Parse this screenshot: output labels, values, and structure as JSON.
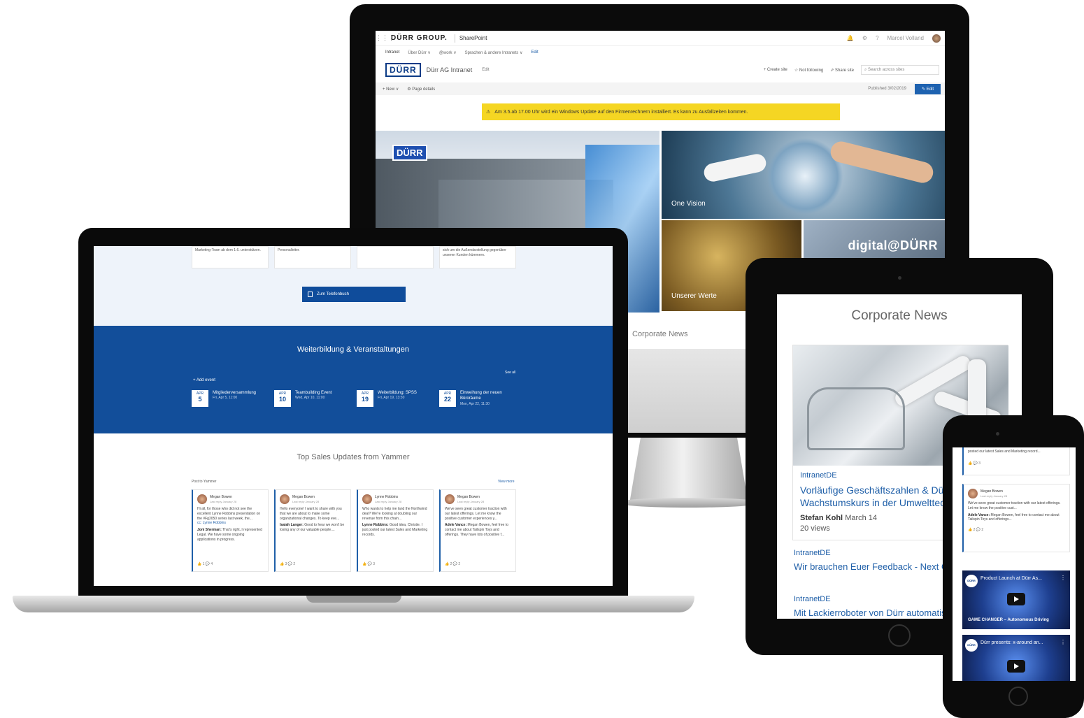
{
  "monitor": {
    "suite": {
      "brand": "DÜRR GROUP.",
      "app": "SharePoint",
      "user": "Marcel Volland",
      "waffle_icon": "waffle-icon"
    },
    "hubnav": [
      "Intranet",
      "Über Dürr ∨",
      "@work ∨",
      "Sprachen & andere Intranets ∨",
      "Edit"
    ],
    "site": {
      "logo": "DÜRR",
      "name": "Dürr AG Intranet",
      "edit": "Edit"
    },
    "actions": {
      "create": "+ Create site",
      "follow": "☆ Not following",
      "share": "⇗ Share site",
      "search_placeholder": "⌕ Search across sites"
    },
    "command": {
      "new": "+ New ∨",
      "page_details": "⚙ Page details",
      "published": "Published 3/02/2019",
      "edit": "✎ Edit"
    },
    "alert": "Am 3.5.ab 17.00 Uhr wird ein Windows Update auf den Firmenrechnern installiert. Es kann zu Ausfallzeiten kommen.",
    "hero": {
      "sign": "DÜRR",
      "vision": "One Vision",
      "werte": "Unserer Werte",
      "digital": "digital@DÜRR"
    },
    "corp_news": "Corporate News"
  },
  "laptop": {
    "cards": [
      "Marketing-Team ab dem 1.6. unterstützen.",
      "Personalleiter.",
      "",
      "sich um die Außendarstellung gegenüber unseren Kunden kümmern."
    ],
    "phone_button": "Zum Telefonbuch",
    "events": {
      "title": "Weiterbildung & Veranstaltungen",
      "add": "+ Add event",
      "see_all": "See all",
      "items": [
        {
          "month": "APR",
          "day": "5",
          "name": "Mitgliederversammlung",
          "when": "Fri, Apr 5, 11:00"
        },
        {
          "month": "APR",
          "day": "10",
          "name": "Teambuilding Event",
          "when": "Wed, Apr 10, 11:00"
        },
        {
          "month": "APR",
          "day": "19",
          "name": "Weiterbildung: SPSS",
          "when": "Fri, Apr 19, 13:30"
        },
        {
          "month": "APR",
          "day": "22",
          "name": "Einweihung der neuen Büroräume",
          "when": "Mon, Apr 22, 11:30"
        }
      ]
    },
    "yammer": {
      "title": "Top Sales Updates from Yammer",
      "post": "Post to Yammer",
      "view_more": "View more",
      "cards": [
        {
          "name": "Megan Bowen",
          "time": "Last reply January 28",
          "body": "Hi all, for those who did not see the excellent Lynne Robbins presentation on the #Fg2050 series last week, the...",
          "extra": "cc: Lynne Robbins",
          "reply_name": "Joni Sherman:",
          "reply": "That's right..I represented Legal. We have some ongoing applications in progress.",
          "foot": "👍 1 💬 4"
        },
        {
          "name": "Megan Bowen",
          "time": "Last reply January 28",
          "body": "Hello everyone! I want to share with you that we are about to make some organizational changes. To keep eve...",
          "extra": "",
          "reply_name": "Isaiah Langer:",
          "reply": "Good to hear we won't be losing any of our valuable people....",
          "foot": "👍 3 💬 2"
        },
        {
          "name": "Lynne Robbins",
          "time": "Last reply January 28",
          "body": "Who wants to help me land the Northwind deal? We're looking at doubling our revenue from this chain...",
          "extra": "",
          "reply_name": "Lynne Robbins:",
          "reply": "Good idea, Christie. I just posted our latest Sales and Marketing records.",
          "foot": "👍 💬 3"
        },
        {
          "name": "Megan Bowen",
          "time": "Last reply January 28",
          "body": "We've seen great customer traction with our latest offerings. Let me know the positive customer experiences y...",
          "extra": "",
          "reply_name": "Adele Vance:",
          "reply": "Megan Bowen, feel free to contact me about Tailspin Toys and offerings. They have lots of positive f...",
          "foot": "👍 2 💬 2"
        }
      ]
    }
  },
  "tablet": {
    "title": "Corporate News",
    "feature": {
      "site": "IntranetDE",
      "headline": "Vorläufige Geschäftszahlen & Dürr auf Wachstumskurs in der Umwelttechnik",
      "author": "Stefan Kohl",
      "date": "March 14",
      "views": "20 views"
    },
    "items": [
      {
        "site": "IntranetDE",
        "headline": "Wir brauchen Euer Feedback - Next Generation"
      },
      {
        "site": "IntranetDE",
        "headline": "Mit Lackierroboter von Dürr automatisiert"
      }
    ]
  },
  "phone": {
    "top_card": {
      "body": "posted our latest Sales and Marketing record...",
      "foot": "👍 💬 3"
    },
    "card": {
      "name": "Megan Bowen",
      "time": "Last reply January 28",
      "body": "We've seen great customer traction with our latest offerings. Let me know the positive cust...",
      "reply_name": "Adele Vance:",
      "reply": "Megan Bowen, feel free to contact me about Tailspin Toys and offerings...",
      "foot": "👍 2 💬 2"
    },
    "videos": [
      {
        "title": "Product Launch at Dürr As...",
        "caption": "GAME CHANGER – Autonomous Driving",
        "logo": "DÜRR"
      },
      {
        "title": "Dürr presents: x-around an...",
        "caption": "",
        "logo": "DÜRR"
      }
    ]
  },
  "colors": {
    "brand_blue": "#124e9a",
    "link_blue": "#1f5fa8",
    "alert_yellow": "#f5d623"
  }
}
